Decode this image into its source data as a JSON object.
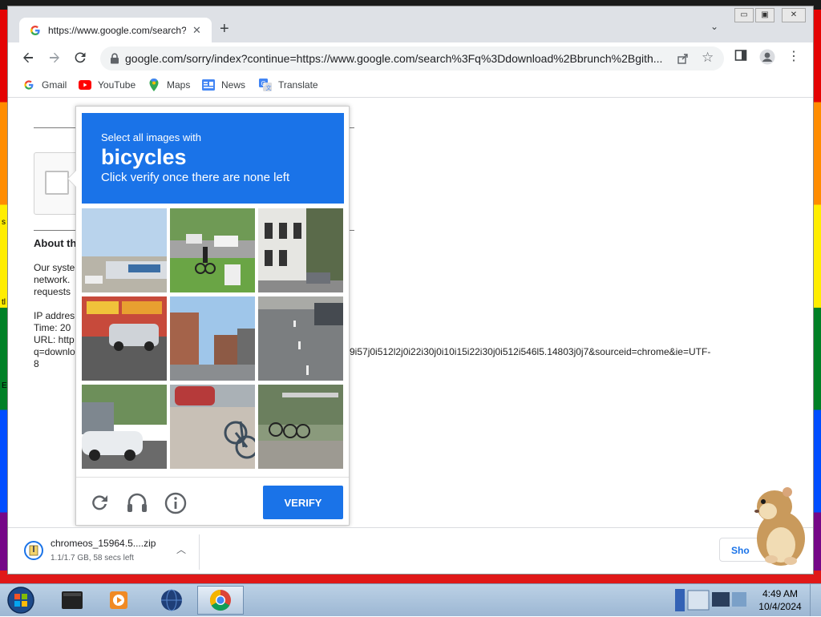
{
  "browser": {
    "tab": {
      "title": "https://www.google.com/search?q"
    },
    "address_bar": {
      "url": "google.com/sorry/index?continue=https://www.google.com/search%3Fq%3Ddownload%2Bbrunch%2Bgith..."
    },
    "bookmarks": [
      {
        "label": "Gmail",
        "icon": "gmail-icon"
      },
      {
        "label": "YouTube",
        "icon": "youtube-icon"
      },
      {
        "label": "Maps",
        "icon": "maps-icon"
      },
      {
        "label": "News",
        "icon": "news-icon"
      },
      {
        "label": "Translate",
        "icon": "translate-icon"
      }
    ]
  },
  "page": {
    "about_title": "About th",
    "para1": [
      "Our syste",
      "network.",
      "requests"
    ],
    "ip_line": "IP addres",
    "time_line": "Time: 20",
    "url_prefix": "URL: http",
    "url_tail": "9i57j0i512l2j0i22i30j0i10i15i22i30j0i512i546l5.14803j0j7&sourceid=chrome&ie=UTF-",
    "url_line2": "q=downlo",
    "url_line3": "8"
  },
  "captcha": {
    "instruction_line1": "Select all images with",
    "target_word": "bicycles",
    "instruction_line3": "Click verify once there are none left",
    "verify_label": "VERIFY",
    "header_color": "#1a73e8"
  },
  "downloads": {
    "item": {
      "filename": "chromeos_15964.5....zip",
      "status": "1.1/1.7 GB, 58 secs left"
    },
    "show_all_label": "Sho"
  },
  "taskbar": {
    "clock_time": "4:49 AM",
    "clock_date": "10/4/2024"
  }
}
